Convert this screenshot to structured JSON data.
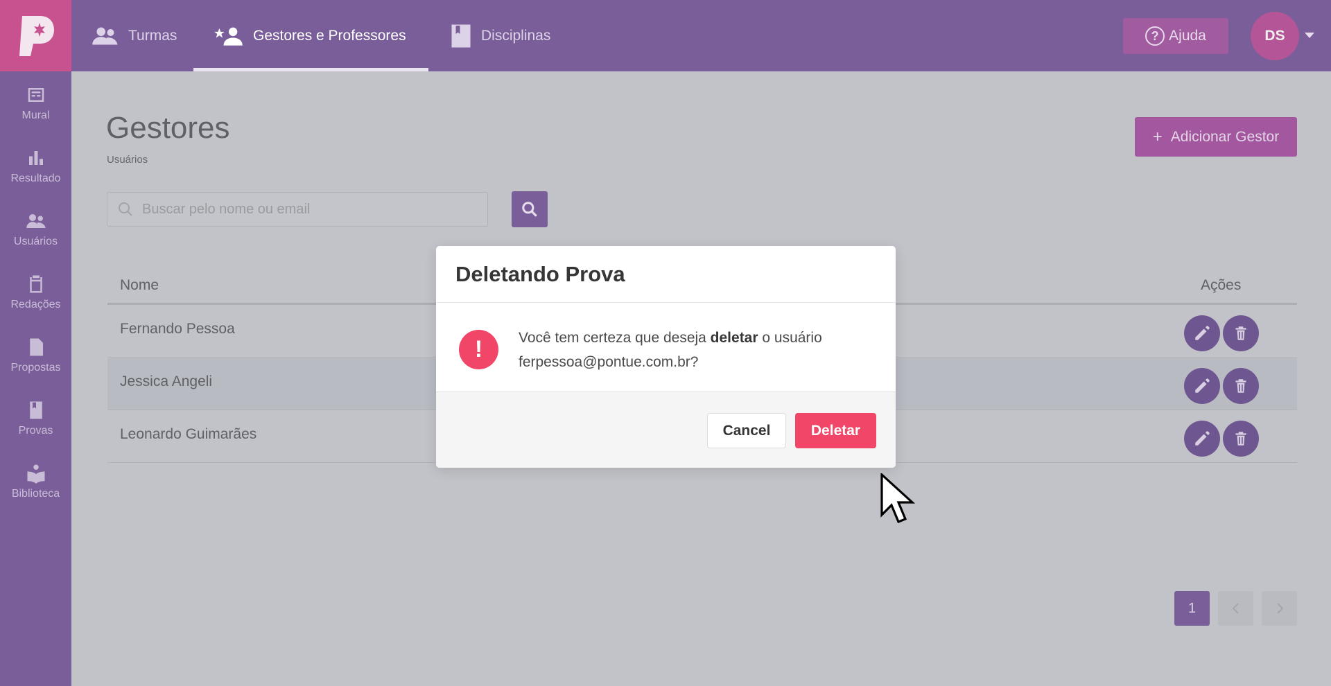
{
  "sidebar": {
    "items": [
      {
        "label": "Mural",
        "icon": "mural-icon"
      },
      {
        "label": "Resultado",
        "icon": "bar-chart-icon"
      },
      {
        "label": "Usuários",
        "icon": "users-icon"
      },
      {
        "label": "Redações",
        "icon": "clipboard-icon"
      },
      {
        "label": "Propostas",
        "icon": "document-icon"
      },
      {
        "label": "Provas",
        "icon": "book-icon"
      },
      {
        "label": "Biblioteca",
        "icon": "library-icon"
      }
    ]
  },
  "topbar": {
    "tabs": [
      {
        "label": "Turmas"
      },
      {
        "label": "Gestores e Professores"
      },
      {
        "label": "Disciplinas"
      }
    ],
    "help_label": "Ajuda",
    "avatar_initials": "DS"
  },
  "main": {
    "title": "Gestores",
    "breadcrumb": "Usuários",
    "add_button": "Adicionar Gestor",
    "search_placeholder": "Buscar pelo nome ou email",
    "table": {
      "columns": [
        "Nome",
        "Ações"
      ],
      "rows": [
        {
          "name": "Fernando Pessoa"
        },
        {
          "name": "Jessica Angeli"
        },
        {
          "name": "Leonardo Guimarães"
        }
      ]
    },
    "pagination": {
      "current": "1"
    }
  },
  "modal": {
    "title": "Deletando Prova",
    "msg_pre": "Você tem certeza que deseja ",
    "msg_bold": "deletar",
    "msg_post": " o usuário",
    "msg_email": "ferpessoa@pontue.com.br?",
    "cancel_label": "Cancel",
    "delete_label": "Deletar"
  },
  "colors": {
    "brand_purple": "#7a5e99",
    "brand_pink": "#c8528f",
    "danger": "#f14668"
  }
}
